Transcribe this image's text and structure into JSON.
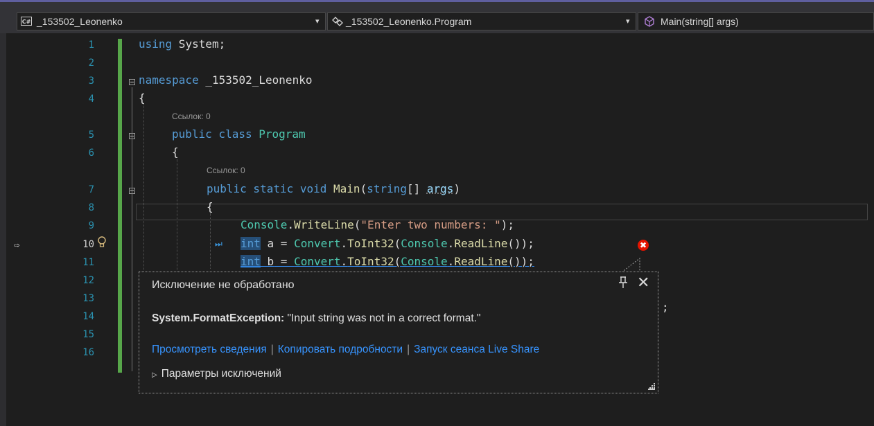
{
  "nav": {
    "project": "_153502_Leonenko",
    "class": "_153502_Leonenko.Program",
    "member": "Main(string[] args)",
    "project_badge": "C#"
  },
  "lines": [
    "1",
    "2",
    "3",
    "4",
    "5",
    "6",
    "7",
    "8",
    "9",
    "10",
    "11",
    "12",
    "13",
    "14",
    "15",
    "16"
  ],
  "codelens": [
    "Ссылок: 0",
    "Ссылок: 0"
  ],
  "code": {
    "l1_kw": "using",
    "l1_rest": " System;",
    "l3_kw": "namespace",
    "l3_rest": " _153502_Leonenko",
    "brace_open": "{",
    "l5_kw": "public class",
    "l5_type": " Program",
    "l7_kw": "public static void",
    "l7_fn": " Main",
    "l7_p1": "(",
    "l7_kw2": "string",
    "l7_p2": "[] ",
    "l7_param": "args",
    "l7_p3": ")",
    "l9_type": "Console",
    "l9_dot": ".",
    "l9_fn": "WriteLine",
    "l9_p1": "(",
    "l9_str": "\"Enter two numbers: \"",
    "l9_p2": ");",
    "l10_kw": "int",
    "l10_var": " a",
    "l10_eq": " = ",
    "l10_type1": "Convert",
    "l10_dot1": ".",
    "l10_fn1": "ToInt32",
    "l10_p1": "(",
    "l10_type2": "Console",
    "l10_dot2": ".",
    "l10_fn2": "ReadLine",
    "l10_p2": "());",
    "l11_kw": "int",
    "l11_var": " b",
    "l11_eq": " = ",
    "l11_type1": "Convert",
    "l11_dot1": ".",
    "l11_fn1": "ToInt32",
    "l11_p1": "(",
    "l11_type2": "Console",
    "l11_dot2": ".",
    "l11_fn2": "ReadLine",
    "l11_p2": "());",
    "l13_tail": ";"
  },
  "exception": {
    "title": "Исключение не обработано",
    "type": "System.FormatException:",
    "message": " \"Input string was not in a correct format.\"",
    "link_details": "Просмотреть сведения",
    "link_copy": "Копировать подробности",
    "link_liveshare": "Запуск сеанса Live Share",
    "params": "Параметры исключений"
  },
  "icons": {
    "exec_arrow": "⇨",
    "next_stmt": "⏭",
    "error": "✖",
    "pin": "⊥",
    "close": "✕",
    "dropdown": "▾",
    "params_triangle": "▷"
  },
  "colors": {
    "keyword": "#569cd6",
    "type": "#4ec9b0",
    "method": "#dcdcaa",
    "string": "#d69d85",
    "param": "#9cdcfe",
    "line_number": "#2b91af",
    "link": "#3794ff",
    "error": "#e51400",
    "changes_bar": "#57a64a"
  }
}
